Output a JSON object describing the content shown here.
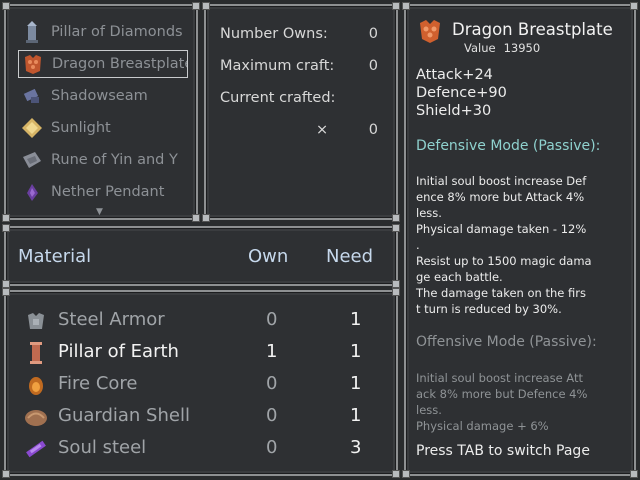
{
  "item_list": {
    "items": [
      {
        "label": "Pillar of Diamonds",
        "icon": "pillar-icon"
      },
      {
        "label": "Dragon Breastplate",
        "icon": "breastplate-icon",
        "selected": true
      },
      {
        "label": "Shadowseam",
        "icon": "shadowseam-icon"
      },
      {
        "label": "Sunlight",
        "icon": "sunlight-icon"
      },
      {
        "label": "Rune of Yin and Y",
        "icon": "rune-icon"
      },
      {
        "label": "Nether Pendant",
        "icon": "pendant-icon"
      }
    ],
    "scroll_down": "▼"
  },
  "craft_info": {
    "number_owns_label": "Number Owns:",
    "number_owns_value": "0",
    "maximum_craft_label": "Maximum craft:",
    "maximum_craft_value": "0",
    "current_crafted_label": "Current crafted:",
    "multiplier_symbol": "×",
    "current_crafted_value": "0"
  },
  "material_header": {
    "material": "Material",
    "own": "Own",
    "need": "Need"
  },
  "materials": [
    {
      "name": "Steel Armor",
      "own": "0",
      "need": "1",
      "icon": "armor-icon",
      "satisfied": false
    },
    {
      "name": "Pillar of Earth",
      "own": "1",
      "need": "1",
      "icon": "pillar-earth-icon",
      "satisfied": true
    },
    {
      "name": "Fire Core",
      "own": "0",
      "need": "1",
      "icon": "fire-core-icon",
      "satisfied": false
    },
    {
      "name": "Guardian Shell",
      "own": "0",
      "need": "1",
      "icon": "shell-icon",
      "satisfied": false
    },
    {
      "name": "Soul steel",
      "own": "0",
      "need": "3",
      "icon": "soul-steel-icon",
      "satisfied": false
    }
  ],
  "detail": {
    "title": "Dragon Breastplate",
    "value_label": "Value",
    "value": "13950",
    "stats": [
      "Attack+24",
      "Defence+90",
      "Shield+30"
    ],
    "defensive_mode_title": "Defensive Mode (Passive):",
    "defensive_mode_text": "Initial soul boost increase Def\nence 8% more but Attack 4%\n less.\nPhysical damage taken - 12%\n.\nResist up to 1500 magic dama\nge each battle.\nThe damage taken on the firs\nt turn is reduced by 30%.",
    "offensive_mode_title": "Offensive Mode (Passive):",
    "offensive_mode_text": "Initial soul boost increase Att\nack 8% more but Defence 4%\n less.\nPhysical damage + 6%",
    "footer": "Press TAB to switch Page"
  },
  "colors": {
    "panel_bg": "#2e3033",
    "border": "#8e9092",
    "header_text": "#c6d8ec",
    "defensive_accent": "#8fd2cf",
    "muted_text": "#8f9396"
  }
}
